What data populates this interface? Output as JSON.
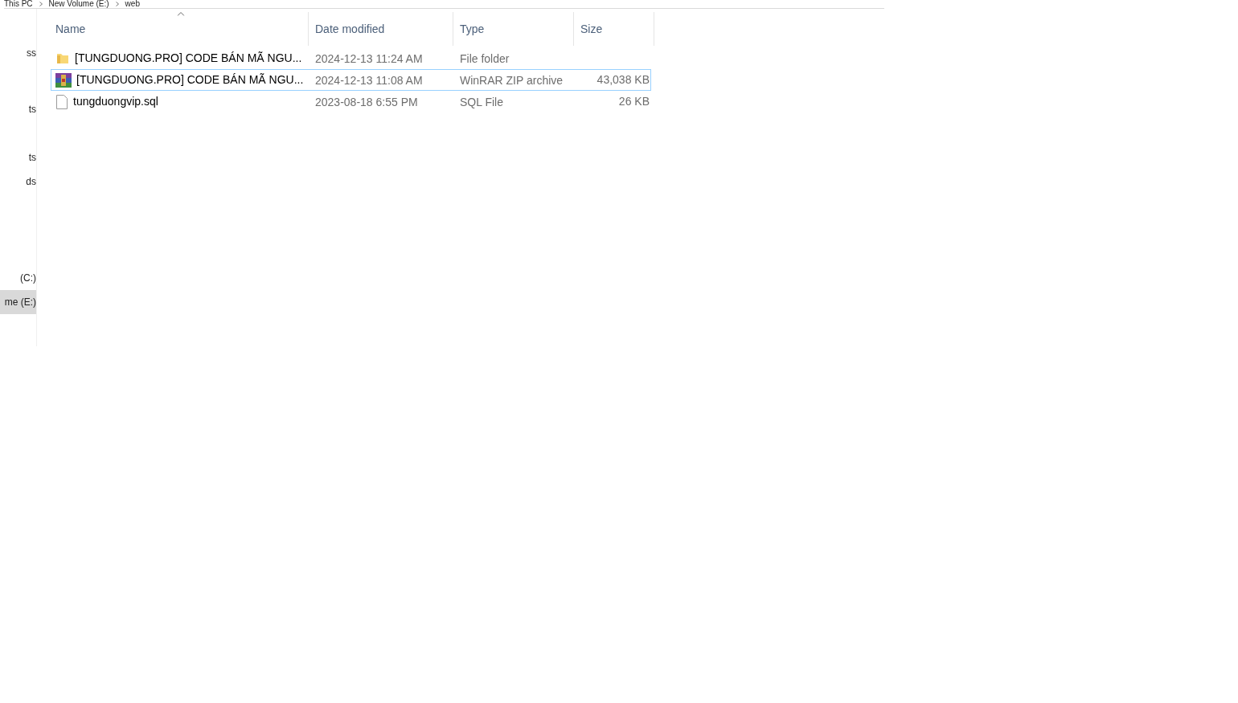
{
  "breadcrumb": [
    "This PC",
    "New Volume (E:)",
    "web"
  ],
  "sidebar": {
    "groups": [
      {
        "items": [
          {
            "label": "ss",
            "selected": false
          }
        ]
      },
      {
        "items": [
          {
            "label": "ts",
            "selected": false
          }
        ]
      },
      {
        "items": [
          {
            "label": "ts",
            "selected": false
          },
          {
            "label": "ds",
            "selected": false
          }
        ]
      },
      {
        "items": [
          {
            "label": "(C:)",
            "selected": false
          },
          {
            "label": "me (E:)",
            "selected": true
          }
        ]
      }
    ]
  },
  "table": {
    "columns": [
      {
        "label": "Name",
        "sorted": true
      },
      {
        "label": "Date modified",
        "sorted": false
      },
      {
        "label": "Type",
        "sorted": false
      },
      {
        "label": "Size",
        "sorted": false
      }
    ],
    "rows": [
      {
        "kind": "folder",
        "focused": false,
        "name": "[TUNGDUONG.PRO] CODE BÁN MÃ NGU...",
        "date": "2024-12-13 11:24 AM",
        "type": "File folder"
      },
      {
        "kind": "archive",
        "focused": true,
        "name": "[TUNGDUONG.PRO] CODE BÁN MÃ NGU...",
        "date": "2024-12-13 11:08 AM",
        "type": "WinRAR ZIP archive",
        "size": "43,038 KB"
      },
      {
        "kind": "file",
        "focused": false,
        "name": "tungduongvip.sql",
        "date": "2023-08-18 6:55 PM",
        "type": "SQL File",
        "size": "26 KB"
      }
    ]
  }
}
